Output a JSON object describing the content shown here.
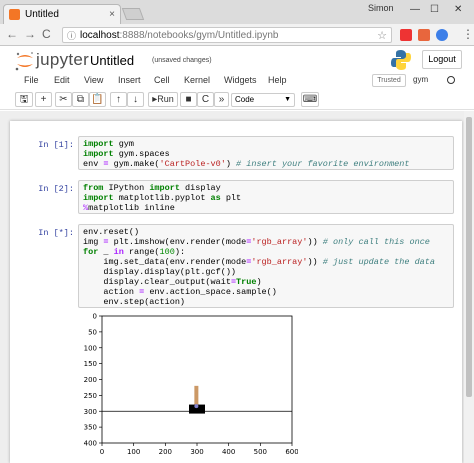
{
  "browser": {
    "tab_title": "Untitled",
    "tab_close": "×",
    "user_name": "Simon",
    "win_minimize": "—",
    "win_maximize": "☐",
    "win_close": "✕",
    "back": "←",
    "forward": "→",
    "reload": "C",
    "url_host": "localhost",
    "url_path": ":8888/notebooks/gym/Untitled.ipynb",
    "star_icon": "☆",
    "menu_icon": "⋮"
  },
  "jupyter": {
    "logo_text": "jupyter",
    "notebook_name": "Untitled",
    "save_status": "(unsaved changes)",
    "logout_label": "Logout",
    "trusted_label": "Trusted",
    "kernel_name": "gym"
  },
  "menu": {
    "items": [
      "File",
      "Edit",
      "View",
      "Insert",
      "Cell",
      "Kernel",
      "Widgets",
      "Help"
    ]
  },
  "toolbar": {
    "save": "🖫",
    "add": "+",
    "cut": "✂",
    "copy": "⧉",
    "paste": "📋",
    "up": "↑",
    "down": "↓",
    "run_label": "Run",
    "stop": "■",
    "restart": "C",
    "restart_run": "»",
    "cell_type": "Code",
    "keyboard": "⌨"
  },
  "cells": [
    {
      "prompt": "In [1]:",
      "lines": [
        [
          [
            "kw",
            "import"
          ],
          [
            "",
            " gym"
          ]
        ],
        [
          [
            "kw",
            "import"
          ],
          [
            "",
            " gym.spaces"
          ]
        ],
        [
          [
            "",
            "env "
          ],
          [
            "op",
            "="
          ],
          [
            "",
            " gym.make("
          ],
          [
            "st",
            "'CartPole-v0'"
          ],
          [
            "",
            ") "
          ],
          [
            "cm",
            "# insert your favorite environment"
          ]
        ]
      ]
    },
    {
      "prompt": "In [2]:",
      "lines": [
        [
          [
            "kw",
            "from"
          ],
          [
            "",
            " IPython "
          ],
          [
            "kw",
            "import"
          ],
          [
            "",
            " display"
          ]
        ],
        [
          [
            "kw",
            "import"
          ],
          [
            "",
            " matplotlib.pyplot "
          ],
          [
            "kw",
            "as"
          ],
          [
            "",
            " plt"
          ]
        ],
        [
          [
            "mg",
            "%"
          ],
          [
            "",
            "matplotlib inline"
          ]
        ]
      ]
    },
    {
      "prompt": "In [*]:",
      "lines": [
        [
          [
            "",
            "env.reset()"
          ]
        ],
        [
          [
            "",
            "img "
          ],
          [
            "op",
            "="
          ],
          [
            "",
            " plt.imshow(env.render(mode"
          ],
          [
            "op",
            "="
          ],
          [
            "st",
            "'rgb_array'"
          ],
          [
            "",
            ")) "
          ],
          [
            "cm",
            "# only call this once"
          ]
        ],
        [
          [
            "kw",
            "for"
          ],
          [
            "",
            " _ "
          ],
          [
            "op",
            "in"
          ],
          [
            "",
            " range("
          ],
          [
            "num",
            "100"
          ],
          [
            "",
            "):"
          ]
        ],
        [
          [
            "",
            "    img.set_data(env.render(mode"
          ],
          [
            "op",
            "="
          ],
          [
            "st",
            "'rgb_array'"
          ],
          [
            "",
            ")) "
          ],
          [
            "cm",
            "# just update the data"
          ]
        ],
        [
          [
            "",
            "    display.display(plt.gcf())"
          ]
        ],
        [
          [
            "",
            "    display.clear_output(wait"
          ],
          [
            "op",
            "="
          ],
          [
            "kw",
            "True"
          ],
          [
            "",
            ")"
          ]
        ],
        [
          [
            "",
            "    action "
          ],
          [
            "op",
            "="
          ],
          [
            "",
            " env.action_space.sample()"
          ]
        ],
        [
          [
            "",
            "    env.step(action)"
          ]
        ]
      ]
    }
  ],
  "chart_data": {
    "type": "image",
    "xlim": [
      0,
      600
    ],
    "ylim": [
      400,
      0
    ],
    "xticks": [
      "0",
      "100",
      "200",
      "300",
      "400",
      "500",
      "600"
    ],
    "yticks": [
      "0",
      "50",
      "100",
      "150",
      "200",
      "250",
      "300",
      "350",
      "400"
    ],
    "track_y": 300,
    "cart": {
      "x": 300,
      "y": 290
    },
    "pole": {
      "x": 298,
      "top_y": 220,
      "bottom_y": 290
    },
    "colors": {
      "track": "#000000",
      "cart": "#000000",
      "pole": "#cc9966",
      "axle": "#8080cc"
    }
  },
  "colors": {
    "prompt": "#303f9f",
    "keyword": "#008000",
    "string": "#ba2121",
    "comment": "#408080",
    "jupyter_orange": "#f37626"
  }
}
